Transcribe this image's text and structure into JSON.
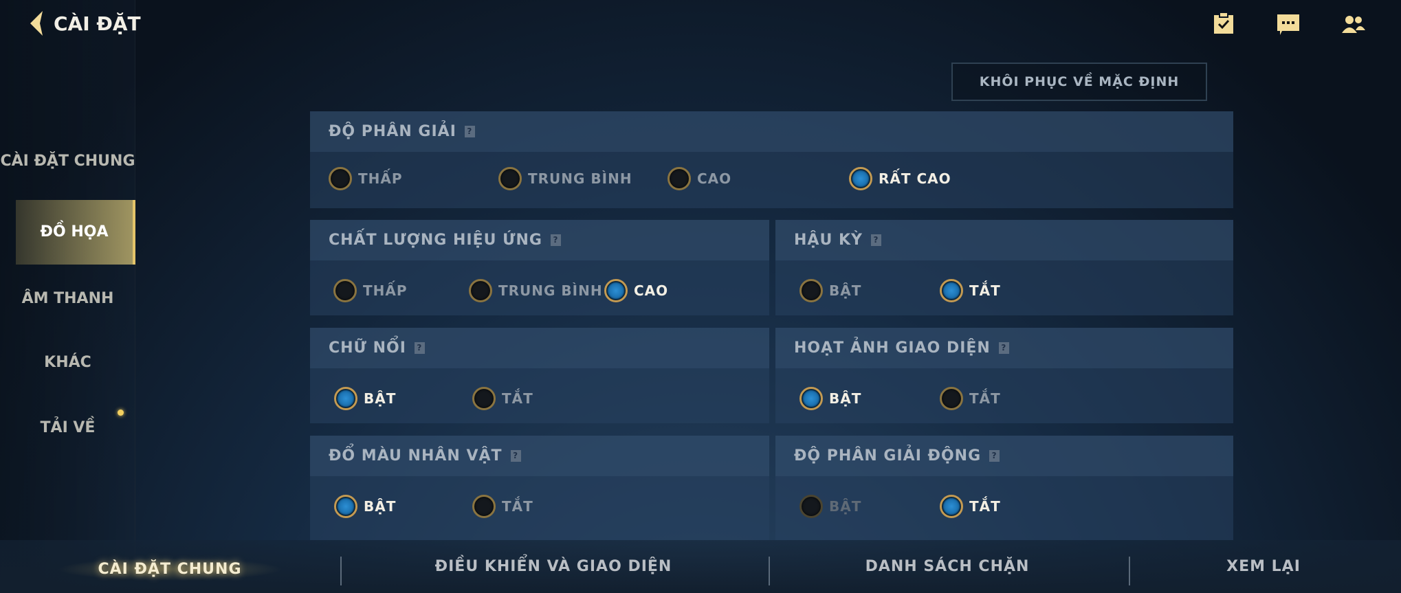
{
  "header": {
    "title": "CÀI ĐẶT",
    "icons": [
      "clipboard-check-icon",
      "chat-icon",
      "friends-icon"
    ],
    "accent": "#f3dc9a"
  },
  "reset_label": "KHÔI PHỤC VỀ MẶC ĐỊNH",
  "sidebar": {
    "items": [
      {
        "label": "CÀI ĐẶT CHUNG",
        "active": false
      },
      {
        "label": "ĐỒ HỌA",
        "active": true
      },
      {
        "label": "ÂM THANH",
        "active": false
      },
      {
        "label": "KHÁC",
        "active": false
      },
      {
        "label": "TẢI VỀ",
        "active": false,
        "notification": true
      }
    ]
  },
  "sections": [
    {
      "title": "ĐỘ PHÂN GIẢI",
      "options": [
        "THẤP",
        "TRUNG BÌNH",
        "CAO",
        "RẤT CAO"
      ],
      "selected": "RẤT CAO"
    },
    {
      "title": "CHẤT LƯỢNG HIỆU ỨNG",
      "options": [
        "THẤP",
        "TRUNG BÌNH",
        "CAO"
      ],
      "selected": "CAO"
    },
    {
      "title": "HẬU KỲ",
      "options": [
        "BẬT",
        "TẮT"
      ],
      "selected": "TẮT"
    },
    {
      "title": "CHỮ NỔI",
      "options": [
        "BẬT",
        "TẮT"
      ],
      "selected": "BẬT"
    },
    {
      "title": "HOẠT ẢNH GIAO DIỆN",
      "options": [
        "BẬT",
        "TẮT"
      ],
      "selected": "BẬT"
    },
    {
      "title": "ĐỔ MÀU NHÂN VẬT",
      "options": [
        "BẬT",
        "TẮT"
      ],
      "selected": "BẬT"
    },
    {
      "title": "ĐỘ PHÂN GIẢI ĐỘNG",
      "options": [
        "BẬT",
        "TẮT"
      ],
      "selected": "TẮT",
      "disabled": [
        "BẬT"
      ]
    }
  ],
  "help_glyph": "?",
  "bottom_tabs": [
    {
      "label": "CÀI ĐẶT CHUNG",
      "active": true
    },
    {
      "label": "ĐIỀU KHIỂN VÀ GIAO DIỆN",
      "active": false
    },
    {
      "label": "DANH SÁCH CHẶN",
      "active": false
    },
    {
      "label": "XEM LẠI",
      "active": false
    }
  ]
}
